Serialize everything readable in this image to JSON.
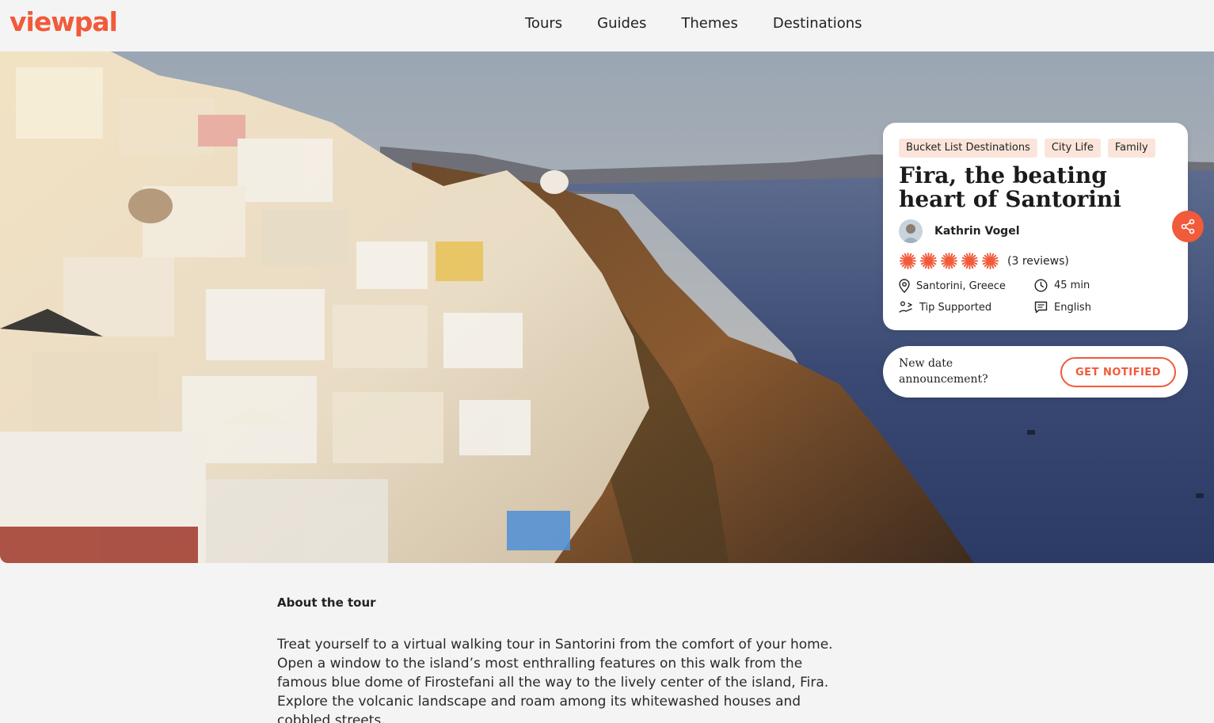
{
  "brand": {
    "logo": "viewpal",
    "accent": "#f15a3a"
  },
  "nav": [
    {
      "label": "Tours"
    },
    {
      "label": "Guides"
    },
    {
      "label": "Themes"
    },
    {
      "label": "Destinations"
    }
  ],
  "tour": {
    "tags": [
      "Bucket List Destinations",
      "City Life",
      "Family"
    ],
    "title": "Fira, the beating heart of Santorini",
    "author": "Kathrin Vogel",
    "rating_stars": 5,
    "reviews": "(3 reviews)",
    "location": "Santorini, Greece",
    "duration": "45 min",
    "tip": "Tip Supported",
    "language": "English"
  },
  "notify": {
    "text": "New date announcement?",
    "button": "GET NOTIFIED"
  },
  "about": {
    "heading": "About the tour",
    "text": "Treat yourself to a virtual walking tour in Santorini from the comfort of your home. Open a window to the island’s most enthralling features on this walk from the famous blue dome of Firostefani all the way to the lively center of the island, Fira. Explore the volcanic landscape and roam among its whitewashed houses and cobbled streets."
  }
}
